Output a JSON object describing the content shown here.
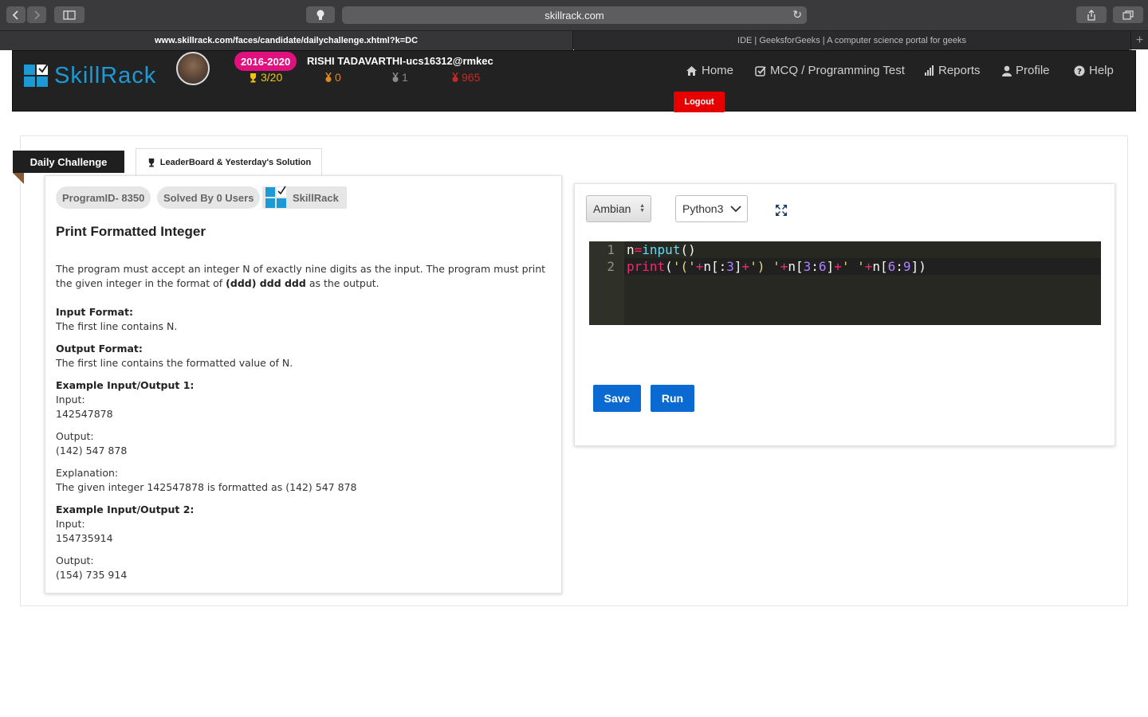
{
  "browser": {
    "address": "skillrack.com",
    "tabs": [
      {
        "label": "www.skillrack.com/faces/candidate/dailychallenge.xhtml?k=DC"
      },
      {
        "label": "IDE | GeeksforGeeks | A computer science portal for geeks"
      }
    ]
  },
  "header": {
    "logo_text_a": "Skill",
    "logo_text_b": "Rack",
    "batch": "2016-2020",
    "user": "RISHI TADAVARTHI-ucs16312@rmkec",
    "stats": [
      {
        "icon": "trophy-icon",
        "value": "3/20",
        "color": "#f1c40f"
      },
      {
        "icon": "medal-icon",
        "value": "0",
        "color": "#e08a1a"
      },
      {
        "icon": "medal-icon",
        "value": "1",
        "color": "#8a8a8a"
      },
      {
        "icon": "medal-icon",
        "value": "965",
        "color": "#c62828"
      }
    ],
    "nav": [
      {
        "icon": "home-icon",
        "label": "Home"
      },
      {
        "icon": "check-square-icon",
        "label": "MCQ / Programming Test"
      },
      {
        "icon": "bar-chart-icon",
        "label": "Reports"
      },
      {
        "icon": "user-icon",
        "label": "Profile"
      },
      {
        "icon": "question-circle-icon",
        "label": "Help"
      }
    ],
    "logout": "Logout"
  },
  "tabs": {
    "daily": "Daily Challenge",
    "leaderboard": "LeaderBoard & Yesterday's Solution"
  },
  "problem": {
    "program_id": "ProgramID- 8350",
    "solved_by": "Solved By 0 Users",
    "source": "SkillRack",
    "title": "Print Formatted Integer",
    "desc_a": "The program must accept an integer N of exactly nine digits as the input. The program must print the given integer in the format of ",
    "desc_bold": "(ddd) ddd ddd",
    "desc_b": " as the output.",
    "input_format_label": "Input Format:",
    "input_format": "The first line contains N.",
    "output_format_label": "Output Format:",
    "output_format": "The first line contains the formatted value of N.",
    "ex1_label": "Example Input/Output 1:",
    "input_label": "Input:",
    "ex1_input": "142547878",
    "output_label": "Output:",
    "ex1_output": "(142) 547 878",
    "explanation_label": "Explanation:",
    "explanation": "The given integer 142547878 is formatted as (142) 547 878",
    "ex2_label": "Example Input/Output 2:",
    "ex2_input": "154735914",
    "ex2_output": "(154) 735 914"
  },
  "editor": {
    "theme": "Ambian",
    "language": "Python3",
    "line_numbers": [
      "1",
      "2"
    ],
    "save": "Save",
    "run": "Run"
  },
  "colors": {
    "accent_blue": "#0a6ad1",
    "logout_red": "#e60000",
    "badge_pink": "#e0107f"
  }
}
